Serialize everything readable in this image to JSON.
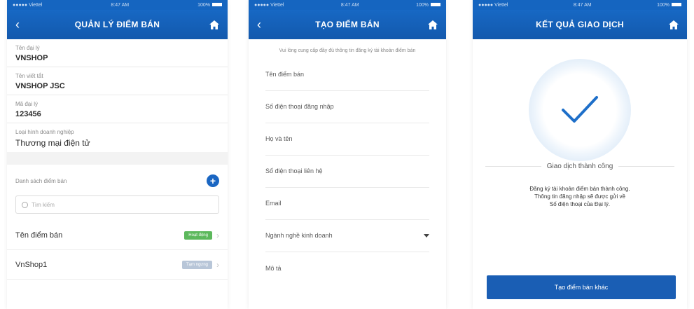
{
  "colors": {
    "primary": "#1565c0",
    "active": "#5cb85c",
    "inactive": "#b8c6d8"
  },
  "screen1": {
    "status": {
      "carrier": "●●●●● Viettel",
      "time": "8:47 AM",
      "battery": "100%"
    },
    "nav": {
      "back": "‹",
      "title": "QUẢN LÝ ĐIỂM BÁN",
      "home_icon": "home-icon"
    },
    "fields": [
      {
        "label": "Tên đại lý",
        "value": "VNSHOP"
      },
      {
        "label": "Tên viết tắt",
        "value": "VNSHOP JSC"
      },
      {
        "label": "Mã đại lý",
        "value": "123456"
      },
      {
        "label": "Loại hình doanh nghiệp",
        "value": "Thương mại điện tử"
      }
    ],
    "list_label": "Danh sách điểm bán",
    "add_icon": "+",
    "search_placeholder": "Tìm kiếm",
    "rows": [
      {
        "name": "Tên điểm bán",
        "status": "Hoạt động"
      },
      {
        "name": "VnShop1",
        "status": "Tạm ngưng"
      }
    ]
  },
  "screen2": {
    "status": {
      "carrier": "●●●●● Viettel",
      "time": "8:47 AM",
      "battery": "100%"
    },
    "nav": {
      "back": "‹",
      "title": "TẠO ĐIỂM BÁN",
      "home_icon": "home-icon"
    },
    "note": "Vui lòng cung cấp đầy đủ thông tin đăng ký tài khoản điểm bán",
    "inputs": [
      "Tên điểm bán",
      "Số điện thoại đăng nhập",
      "Họ và tên",
      "Số điện thoại liên hệ",
      "Email",
      "Ngành nghề kinh doanh",
      "Mô tả"
    ]
  },
  "screen3": {
    "status": {
      "carrier": "●●●●● Viettel",
      "time": "8:47 AM",
      "battery": "100%"
    },
    "nav": {
      "title": "KẾT QUẢ GIAO DỊCH",
      "home_icon": "home-icon"
    },
    "success": "Giao dịch thành công",
    "desc1": "Đăng ký tài khoản điểm bán thành công.",
    "desc2": "Thông tin đăng nhập sẽ được gửi về",
    "desc3": "Số điện thoại của Đại lý.",
    "button": "Tạo điểm bán khác"
  }
}
